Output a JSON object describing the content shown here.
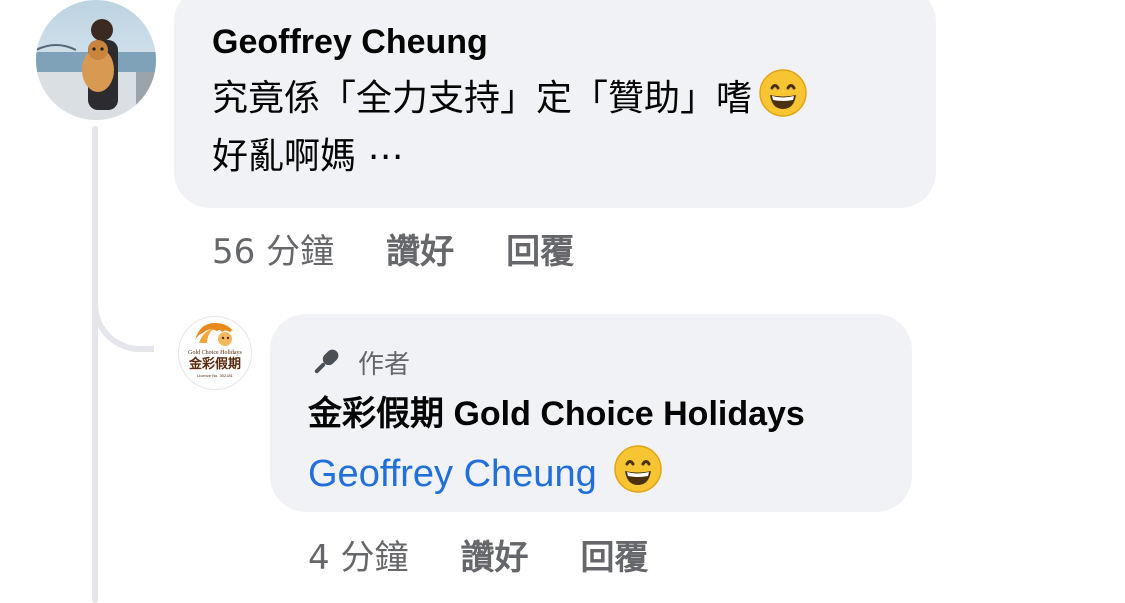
{
  "comments": [
    {
      "author": "Geoffrey Cheung",
      "text_line1": "究竟係「全力支持」定「贊助」嗜",
      "text_line2": "好亂啊媽 ⋯",
      "emoji": "grinning-face-emoji",
      "time": "56 分鐘",
      "like_label": "讚好",
      "reply_label": "回覆"
    },
    {
      "badge": "作者",
      "author": "金彩假期 Gold Choice Holidays",
      "mention": "Geoffrey Cheung",
      "emoji": "grinning-face-emoji",
      "time": "4 分鐘",
      "like_label": "讚好",
      "reply_label": "回覆"
    }
  ],
  "logo": {
    "name_zh": "金彩假期",
    "name_en": "Gold Choice Holidays",
    "license": "Licence No. 352181"
  },
  "colors": {
    "bubble": "#f0f2f5",
    "secondary_text": "#65676b",
    "mention": "#216fdb",
    "logo_orange": "#e8891c",
    "logo_dark": "#5a2a0e"
  }
}
